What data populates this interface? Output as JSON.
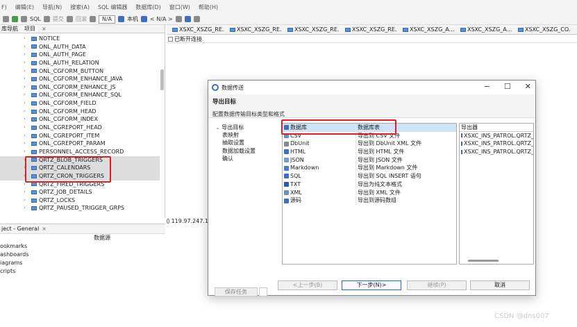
{
  "menubar": {
    "items": [
      "F)",
      "编辑(E)",
      "导航(N)",
      "搜索(A)",
      "SQL 编辑器",
      "数据库(D)",
      "窗口(W)",
      "帮助(H)"
    ]
  },
  "toolbar": {
    "sql_label": "SQL",
    "submit_label": "提交",
    "rollback_label": "回滚",
    "na_label": "N/A",
    "local_label": "本机",
    "na_select": "< N/A >"
  },
  "left_panel": {
    "tab_nav": "库导航",
    "tab_project": "项目",
    "tree_items": [
      {
        "label": "NOTICE",
        "selected": false
      },
      {
        "label": "ONL_AUTH_DATA",
        "selected": false
      },
      {
        "label": "ONL_AUTH_PAGE",
        "selected": false
      },
      {
        "label": "ONL_AUTH_RELATION",
        "selected": false
      },
      {
        "label": "ONL_CGFORM_BUTTON",
        "selected": false
      },
      {
        "label": "ONL_CGFORM_ENHANCE_JAVA",
        "selected": false
      },
      {
        "label": "ONL_CGFORM_ENHANCE_JS",
        "selected": false
      },
      {
        "label": "ONL_CGFORM_ENHANCE_SQL",
        "selected": false
      },
      {
        "label": "ONL_CGFORM_FIELD",
        "selected": false
      },
      {
        "label": "ONL_CGFORM_HEAD",
        "selected": false
      },
      {
        "label": "ONL_CGFORM_INDEX",
        "selected": false
      },
      {
        "label": "ONL_CGREPORT_HEAD",
        "selected": false
      },
      {
        "label": "ONL_CGREPORT_ITEM",
        "selected": false
      },
      {
        "label": "ONL_CGREPORT_PARAM",
        "selected": false
      },
      {
        "label": "PERSONNEL_ACCESS_RECORD",
        "selected": false
      },
      {
        "label": "QRTZ_BLOB_TRIGGERS",
        "selected": true
      },
      {
        "label": "QRTZ_CALENDARS",
        "selected": true
      },
      {
        "label": "QRTZ_CRON_TRIGGERS",
        "selected": true
      },
      {
        "label": "QRTZ_FIRED_TRIGGERS",
        "selected": false
      },
      {
        "label": "QRTZ_JOB_DETAILS",
        "selected": false
      },
      {
        "label": "QRTZ_LOCKS",
        "selected": false
      },
      {
        "label": "QRTZ_PAUSED_TRIGGER_GRPS",
        "selected": false
      }
    ]
  },
  "project_panel": {
    "title": "ject - General",
    "col_header": "数据源",
    "items": [
      "ookmarks",
      "ashboards",
      "iagrams",
      "cripts"
    ]
  },
  "editor_tabs": [
    "XSXC_XSZG_RE...",
    "XSXC_XSZG_RE...",
    "XSXC_XSZG_RE...",
    "XSXC_XSZG_RE...",
    "XSXC_XSZG_A...",
    "XSXC_XSZG_A...",
    "XSXC_XSZG_CO..."
  ],
  "disconnected_label": "已断开连接",
  "ip_label": "119.97.247.1",
  "dialog": {
    "title": "数据传送",
    "header_title": "导出目标",
    "header_subtitle": "配置数据传输目标类型和格式",
    "steps": [
      "导出目标",
      "表映射",
      "抽取设置",
      "数据加载设置",
      "确认"
    ],
    "save_task_label": "保存任务",
    "types": [
      {
        "name": "数据库",
        "desc": "数据库表",
        "icon_color": "#3b6fbf",
        "selected": true
      },
      {
        "name": "CSV",
        "desc": "导出到 CSV 文件",
        "icon_color": "#6b8fbf",
        "selected": false
      },
      {
        "name": "DbUnit",
        "desc": "导出到 DbUnit XML 文件",
        "icon_color": "#8a8a8a",
        "selected": false
      },
      {
        "name": "HTML",
        "desc": "导出到 HTML 文件",
        "icon_color": "#3b6fbf",
        "selected": false
      },
      {
        "name": "JSON",
        "desc": "导出到 JSON 文件",
        "icon_color": "#7a9ac7",
        "selected": false
      },
      {
        "name": "Markdown",
        "desc": "导出到 Markdown 文件",
        "icon_color": "#4a7ac0",
        "selected": false
      },
      {
        "name": "SQL",
        "desc": "导出到 SQL INSERT 语句",
        "icon_color": "#3b6fbf",
        "selected": false
      },
      {
        "name": "TXT",
        "desc": "导出为纯文本格式",
        "icon_color": "#2a5aa8",
        "selected": false
      },
      {
        "name": "XML",
        "desc": "导出到 XML 文件",
        "icon_color": "#6b8fbf",
        "selected": false
      },
      {
        "name": "源码",
        "desc": "导出到源码数组",
        "icon_color": "#3b6fbf",
        "selected": false
      }
    ],
    "exporter_header": "导出器",
    "exporter_items": [
      "XSXC_INS_PATROL.QRTZ_",
      "XSXC_INS_PATROL.QRTZ_",
      "XSXC_INS_PATROL.QRTZ_"
    ],
    "buttons": {
      "prev": "<上一步(B)",
      "next": "下一步(N)>",
      "proceed": "继续(P)",
      "cancel": "取消"
    }
  },
  "watermark": "CSDN @dns007"
}
